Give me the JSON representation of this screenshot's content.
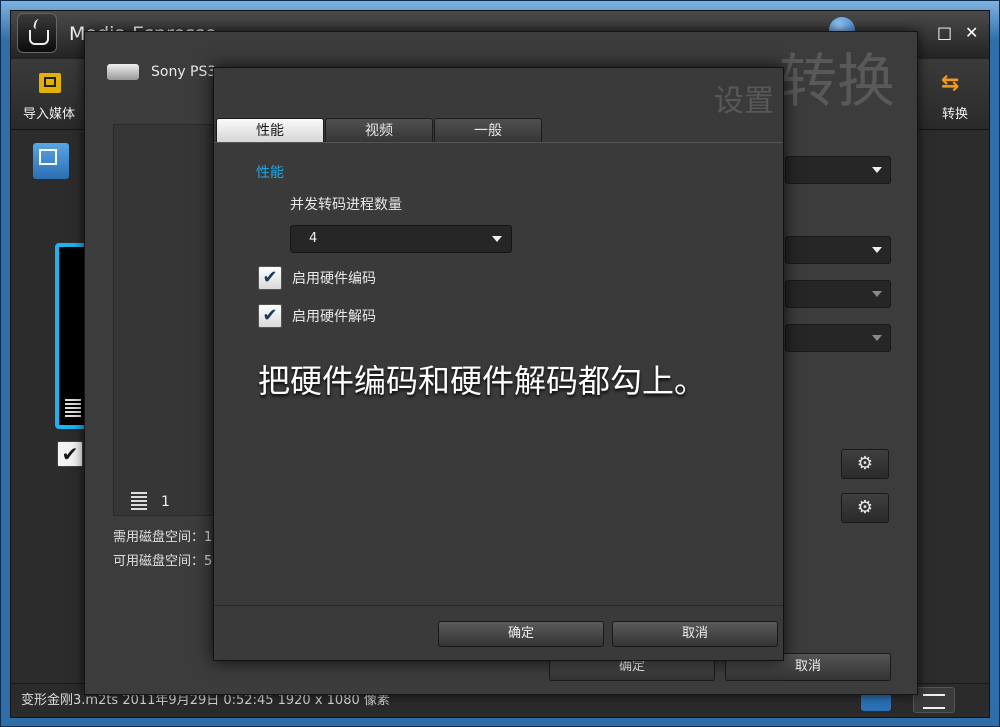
{
  "app": {
    "title": "Media Espresso",
    "window_controls": {
      "minimize": "–",
      "maximize": "□",
      "close": "✕"
    }
  },
  "toolbar": {
    "import_label": "导入媒体",
    "convert_label": "转换",
    "convert_icon": "swap-arrows-icon"
  },
  "media_item": {
    "checked": true
  },
  "statusbar": {
    "text": "变形金刚3.m2ts  2011年9月29日  0:52:45  1920 x 1080 像素"
  },
  "profile_dialog": {
    "device_name": "Sony PS3",
    "heading": "转换",
    "preview_count": "1",
    "disk_needed_label": "需用磁盘空间：1",
    "disk_free_label": "可用磁盘空间：5",
    "ok_label": "确定",
    "cancel_label": "取消"
  },
  "settings_dialog": {
    "heading": "设置",
    "tabs": [
      {
        "label": "性能",
        "active": true
      },
      {
        "label": "视频",
        "active": false
      },
      {
        "label": "一般",
        "active": false
      }
    ],
    "section_title": "性能",
    "concurrent_label": "并发转码进程数量",
    "concurrent_value": "4",
    "hw_encode_label": "启用硬件编码",
    "hw_encode_checked": true,
    "hw_decode_label": "启用硬件解码",
    "hw_decode_checked": true,
    "ok_label": "确定",
    "cancel_label": "取消"
  },
  "annotation": "把硬件编码和硬件解码都勾上。",
  "colors": {
    "accent": "#22a6e2",
    "selection_border": "#1eb2f0",
    "convert_icon": "#f39a1e"
  }
}
